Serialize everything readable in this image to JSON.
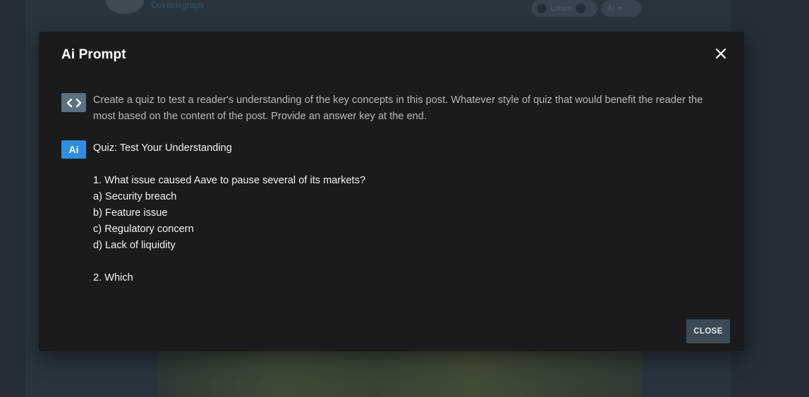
{
  "background": {
    "author_name": "Cointelegraph",
    "listen_label": "Listen",
    "ai_label": "AI"
  },
  "modal": {
    "title": "Ai Prompt",
    "prompt_icon": "code-icon",
    "prompt_text": "Create a quiz to test a reader's understanding of the key concepts in this post. Whatever style of quiz that would benefit the reader the most based on the content of the post. Provide an answer key at the end.",
    "ai_badge": "Ai",
    "answer_lines": [
      "Quiz: Test Your Understanding",
      "",
      "1. What issue caused Aave to pause several of its markets?",
      "a) Security breach",
      "b) Feature issue",
      "c) Regulatory concern",
      "d) Lack of liquidity",
      "",
      "2. Which"
    ],
    "close_button_label": "CLOSE"
  },
  "colors": {
    "modal_bg": "#1a1b1d",
    "prompt_icon_bg": "#5c7080",
    "ai_badge_bg": "#2f8ee0",
    "close_button_bg": "#3b4a54"
  }
}
